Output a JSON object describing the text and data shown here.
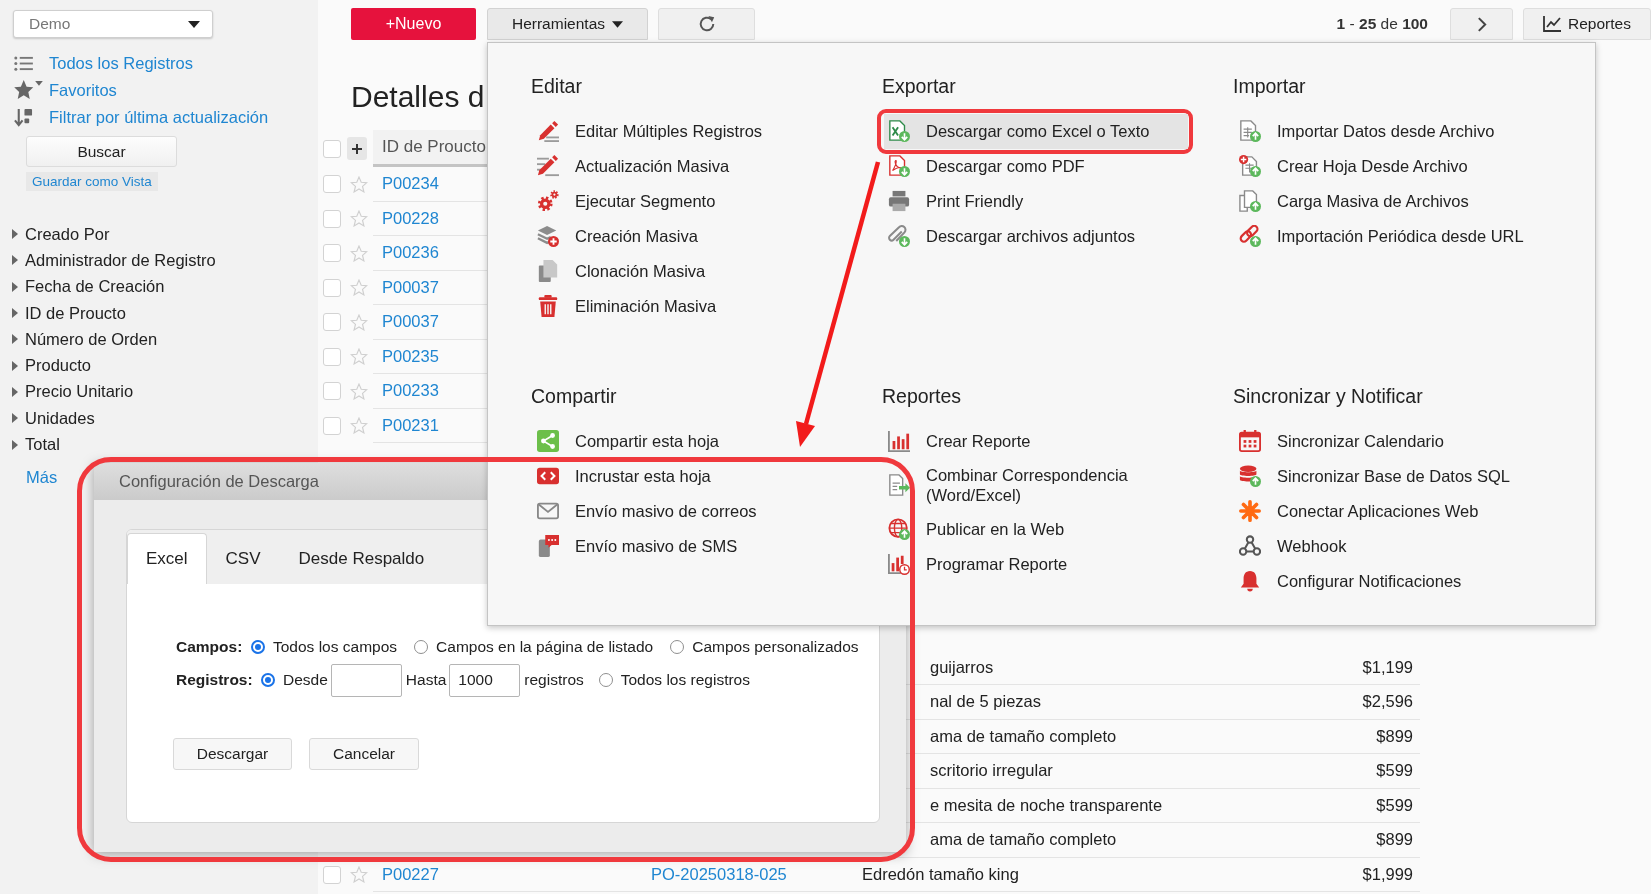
{
  "sidebar": {
    "view_select": {
      "value": "Demo"
    },
    "links": [
      {
        "label": "Todos los Registros"
      },
      {
        "label": "Favoritos"
      },
      {
        "label": "Filtrar por última actualización"
      }
    ],
    "search_button": "Buscar",
    "save_view_link": "Guardar como Vista",
    "fields": [
      {
        "label": "Creado Por",
        "expanded": false
      },
      {
        "label": "Administrador de Registro",
        "expanded": false
      },
      {
        "label": "Fecha de Creación",
        "expanded": false
      },
      {
        "label": "ID de Proucto",
        "expanded": false
      },
      {
        "label": "Número de Orden",
        "expanded": false
      },
      {
        "label": "Producto",
        "expanded": false
      },
      {
        "label": "Precio Unitario",
        "expanded": false
      },
      {
        "label": "Unidades",
        "expanded": false
      },
      {
        "label": "Total",
        "expanded": false
      }
    ],
    "more_link": "Más"
  },
  "toolbar": {
    "new_button": "+Nuevo",
    "tools_button": {
      "label": "Herramientas",
      "expanded": true
    },
    "pagination": "**1** - **25** de **100**",
    "reports_button": "Reportes"
  },
  "page_title": "Detalles d",
  "table": {
    "header": {
      "checked": false,
      "id_column": "ID de Proucto"
    },
    "rows": [
      {
        "checked": false,
        "starred": false,
        "id": "P00234"
      },
      {
        "checked": false,
        "starred": false,
        "id": "P00228"
      },
      {
        "checked": false,
        "starred": false,
        "id": "P00236"
      },
      {
        "checked": false,
        "starred": false,
        "id": "P00037"
      },
      {
        "checked": false,
        "starred": false,
        "id": "P00037"
      },
      {
        "checked": false,
        "starred": false,
        "id": "P00235"
      },
      {
        "checked": false,
        "starred": false,
        "id": "P00233"
      },
      {
        "checked": false,
        "starred": false,
        "id": "P00231"
      }
    ],
    "lower_rows": [
      {
        "product": "guijarros",
        "price": "$1,199"
      },
      {
        "product": "nal de 5 piezas",
        "price": "$2,596"
      },
      {
        "product": "ama de tamaño completo",
        "price": "$899"
      },
      {
        "product": "scritorio irregular",
        "price": "$599"
      },
      {
        "product": "e mesita de noche transparente",
        "price": "$599"
      },
      {
        "product": "ama de tamaño completo",
        "price": "$899"
      },
      {
        "checked": false,
        "starred": false,
        "id": "P00227",
        "order": "PO-20250318-025",
        "product": "Edredón tamaño king",
        "price": "$1,999"
      }
    ]
  },
  "tools_menu": {
    "sections": [
      {
        "title": "Editar",
        "items": [
          {
            "label": "Editar Múltiples Registros",
            "selected": false
          },
          {
            "label": "Actualización Masiva",
            "selected": false
          },
          {
            "label": "Ejecutar Segmento",
            "selected": false
          },
          {
            "label": "Creación Masiva",
            "selected": false
          },
          {
            "label": "Clonación Masiva",
            "selected": false
          },
          {
            "label": "Eliminación Masiva",
            "selected": false
          }
        ]
      },
      {
        "title": "Exportar",
        "items": [
          {
            "label": "Descargar como Excel o Texto",
            "selected": true
          },
          {
            "label": "Descargar como PDF",
            "selected": false
          },
          {
            "label": "Print Friendly",
            "selected": false
          },
          {
            "label": "Descargar archivos adjuntos",
            "selected": false
          }
        ]
      },
      {
        "title": "Importar",
        "items": [
          {
            "label": "Importar Datos desde Archivo",
            "selected": false
          },
          {
            "label": "Crear Hoja Desde Archivo",
            "selected": false
          },
          {
            "label": "Carga Masiva de Archivos",
            "selected": false
          },
          {
            "label": "Importación Periódica desde URL",
            "selected": false
          }
        ]
      },
      {
        "title": "Compartir",
        "items": [
          {
            "label": "Compartir esta hoja",
            "selected": false
          },
          {
            "label": "Incrustar esta hoja",
            "selected": false
          },
          {
            "label": "Envío masivo de correos",
            "selected": false
          },
          {
            "label": "Envío masivo de SMS",
            "selected": false
          }
        ]
      },
      {
        "title": "Reportes",
        "items": [
          {
            "label": "Crear Reporte",
            "selected": false
          },
          {
            "label": "Combinar Correspondencia (Word/Excel)",
            "selected": false
          },
          {
            "label": "Publicar en la Web",
            "selected": false
          },
          {
            "label": "Programar Reporte",
            "selected": false
          }
        ]
      },
      {
        "title": "Sincronizar y Notificar",
        "items": [
          {
            "label": "Sincronizar Calendario",
            "selected": false
          },
          {
            "label": "Sincronizar Base de Datos SQL",
            "selected": false
          },
          {
            "label": "Conectar Aplicaciones Web",
            "selected": false
          },
          {
            "label": "Webhook",
            "selected": false
          },
          {
            "label": "Configurar Notificaciones",
            "selected": false
          }
        ]
      }
    ]
  },
  "download_dialog": {
    "title": "Configuración de Descarga",
    "tabs": [
      {
        "label": "Excel",
        "selected": true
      },
      {
        "label": "CSV",
        "selected": false
      },
      {
        "label": "Desde Respaldo",
        "selected": false
      }
    ],
    "fields": {
      "label": "Campos:",
      "options": [
        {
          "label": "Todos los campos",
          "selected": true
        },
        {
          "label": "Campos en la página de listado",
          "selected": false
        },
        {
          "label": "Campos personalizados",
          "selected": false
        }
      ]
    },
    "records": {
      "label": "Registros:",
      "range_option": {
        "label": "Desde",
        "selected": true
      },
      "to_label": "Hasta",
      "to_field": {
        "value": "1000"
      },
      "unit": "registros",
      "all_option": {
        "label": "Todos los registros",
        "selected": false
      }
    },
    "buttons": [
      "Descargar",
      "Cancelar"
    ]
  }
}
